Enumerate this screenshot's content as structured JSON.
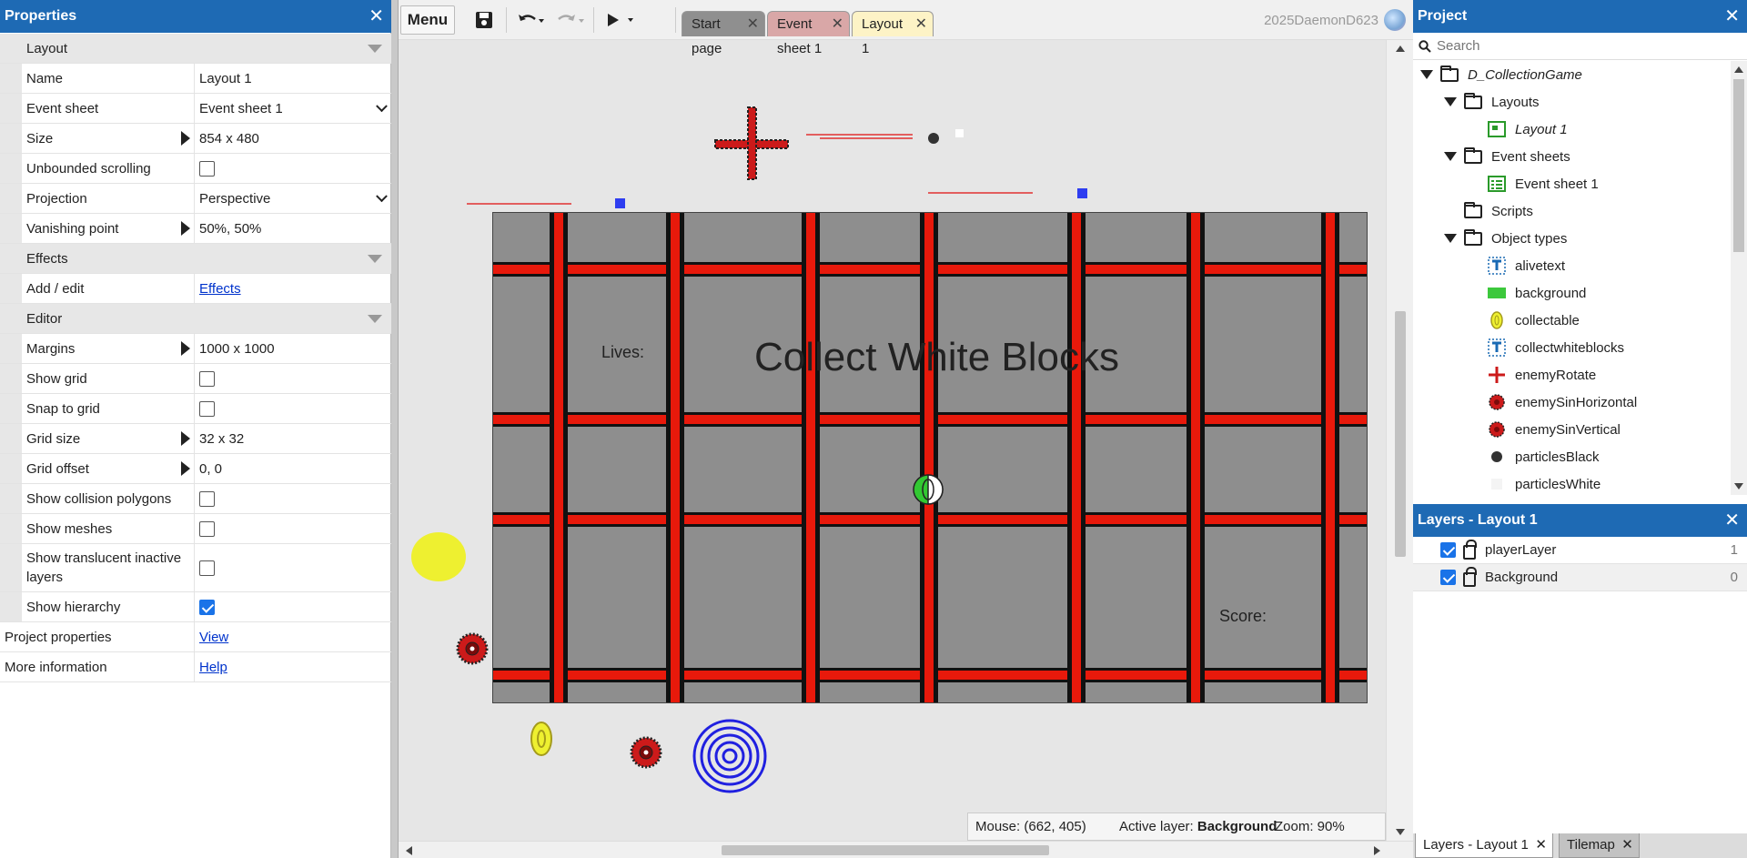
{
  "properties_panel": {
    "title": "Properties",
    "rows": [
      {
        "kind": "section",
        "label": "Layout"
      },
      {
        "kind": "text",
        "label": "Name",
        "value": "Layout 1"
      },
      {
        "kind": "select",
        "label": "Event sheet",
        "value": "Event sheet 1"
      },
      {
        "kind": "expand",
        "label": "Size",
        "value": "854 x 480"
      },
      {
        "kind": "check",
        "label": "Unbounded scrolling",
        "checked": false
      },
      {
        "kind": "select",
        "label": "Projection",
        "value": "Perspective"
      },
      {
        "kind": "expand",
        "label": "Vanishing point",
        "value": "50%, 50%"
      },
      {
        "kind": "section",
        "label": "Effects"
      },
      {
        "kind": "link",
        "label": "Add / edit",
        "value": "Effects"
      },
      {
        "kind": "section",
        "label": "Editor"
      },
      {
        "kind": "expand",
        "label": "Margins",
        "value": "1000 x 1000"
      },
      {
        "kind": "check",
        "label": "Show grid",
        "checked": false
      },
      {
        "kind": "check",
        "label": "Snap to grid",
        "checked": false
      },
      {
        "kind": "expand",
        "label": "Grid size",
        "value": "32 x 32"
      },
      {
        "kind": "expand",
        "label": "Grid offset",
        "value": "0, 0"
      },
      {
        "kind": "check",
        "label": "Show collision polygons",
        "checked": false
      },
      {
        "kind": "check",
        "label": "Show meshes",
        "checked": false
      },
      {
        "kind": "check",
        "label": "Show translucent inactive layers",
        "checked": false,
        "tall": true
      },
      {
        "kind": "check",
        "label": "Show hierarchy",
        "checked": true
      },
      {
        "kind": "toplink",
        "label": "Project properties",
        "value": "View"
      },
      {
        "kind": "toplink",
        "label": "More information",
        "value": "Help"
      }
    ]
  },
  "toolbar": {
    "menu_label": "Menu",
    "tabs": [
      {
        "label": "Start page",
        "color": "#8f8f8f",
        "active": false
      },
      {
        "label": "Event sheet 1",
        "color": "#d9a7a7",
        "active": false
      },
      {
        "label": "Layout 1",
        "color": "#fdf3c6",
        "active": true
      }
    ],
    "user_name": "2025DaemonD623"
  },
  "layout_view": {
    "lives_label": "Lives:",
    "title_text": "Collect White Blocks",
    "score_label": "Score:"
  },
  "status_bar": {
    "mouse": "Mouse: (662, 405)",
    "active_layer_label": "Active layer: ",
    "active_layer_value": "Background",
    "zoom": "Zoom: 90%"
  },
  "project_panel": {
    "title": "Project",
    "search_placeholder": "Search",
    "root": "D_CollectionGame",
    "layouts_folder": "Layouts",
    "layout_item": "Layout 1",
    "event_sheets_folder": "Event sheets",
    "event_sheet_item": "Event sheet 1",
    "scripts_folder": "Scripts",
    "object_types_folder": "Object types",
    "object_types": [
      {
        "name": "alivetext",
        "icon": "text-icon"
      },
      {
        "name": "background",
        "icon": "sprite-green-icon"
      },
      {
        "name": "collectable",
        "icon": "collectable-icon"
      },
      {
        "name": "collectwhiteblocks",
        "icon": "text-icon"
      },
      {
        "name": "enemyRotate",
        "icon": "enemy-rotate-icon"
      },
      {
        "name": "enemySinHorizontal",
        "icon": "enemy-sin-icon"
      },
      {
        "name": "enemySinVertical",
        "icon": "enemy-sin-icon"
      },
      {
        "name": "particlesBlack",
        "icon": "particles-black-icon"
      },
      {
        "name": "particlesWhite",
        "icon": "particles-white-icon"
      }
    ]
  },
  "layers_panel": {
    "title": "Layers - Layout 1",
    "layers": [
      {
        "name": "playerLayer",
        "number": "1",
        "visible": true,
        "selected": false
      },
      {
        "name": "Background",
        "number": "0",
        "visible": true,
        "selected": true
      }
    ],
    "bottom_tabs": [
      "Layers - Layout 1",
      "Tilemap"
    ]
  },
  "colors": {
    "accent": "#1e6ab4",
    "grid_red": "#e8190b",
    "grid_gray": "#8e8e8e"
  }
}
